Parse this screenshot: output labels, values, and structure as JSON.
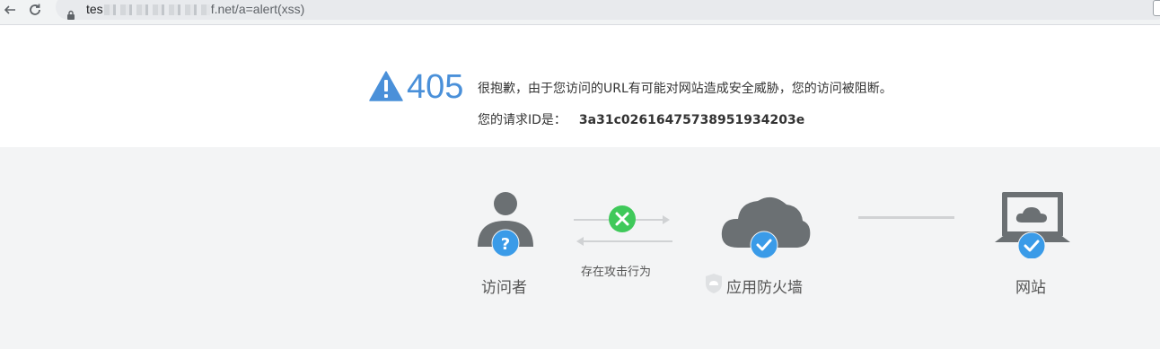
{
  "browser": {
    "url_prefix": "tes",
    "url_suffix": "f.net/a=alert(xss)",
    "icons": [
      "back-arrow-icon",
      "reload-icon",
      "lock-icon"
    ]
  },
  "error": {
    "code": "405",
    "message": "很抱歉，由于您访问的URL有可能对网站造成安全威胁，您的访问被阻断。",
    "request_label": "您的请求ID是：",
    "request_id": "3a31c02616475738951934203e"
  },
  "diagram": {
    "visitor_label": "访问者",
    "attack_label": "存在攻击行为",
    "firewall_label": "应用防火墙",
    "website_label": "网站",
    "colors": {
      "accent_blue": "#4a90d9",
      "badge_blue": "#3a9be8",
      "block_green": "#3fc95a",
      "icon_gray": "#6b7073",
      "line_gray": "#d0d2d4"
    }
  }
}
